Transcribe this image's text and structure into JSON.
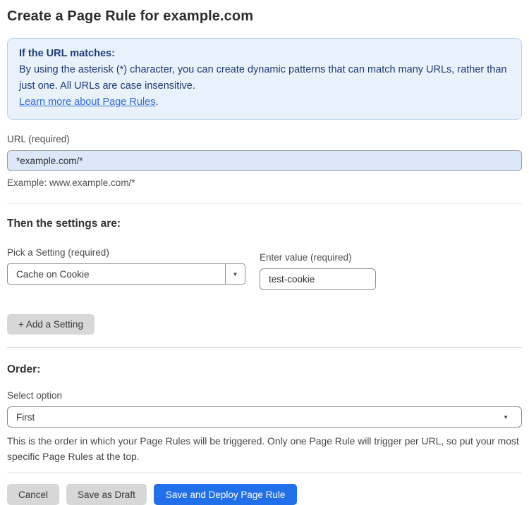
{
  "page": {
    "title": "Create a Page Rule for example.com"
  },
  "info_box": {
    "heading": "If the URL matches:",
    "body": "By using the asterisk (*) character, you can create dynamic patterns that can match many URLs, rather than just one. All URLs are case insensitive.",
    "link_label": "Learn more about Page Rules",
    "link_suffix": "."
  },
  "url_field": {
    "label": "URL (required)",
    "value": "*example.com/*",
    "helper": "Example: www.example.com/*"
  },
  "settings_section": {
    "heading": "Then the settings are:",
    "setting_label": "Pick a Setting (required)",
    "setting_selected": "Cache on Cookie",
    "dropdown_icon": "▼",
    "value_label": "Enter value (required)",
    "value": "test-cookie",
    "add_button_label": "+ Add a Setting"
  },
  "order_section": {
    "heading": "Order:",
    "select_label": "Select option",
    "selected_option": "First",
    "dropdown_icon": "▼",
    "helper": "This is the order in which your Page Rules will be triggered. Only one Page Rule will trigger per URL, so put your most specific Page Rules at the top."
  },
  "footer": {
    "cancel_label": "Cancel",
    "save_draft_label": "Save as Draft",
    "save_deploy_label": "Save and Deploy Page Rule"
  },
  "colors": {
    "info_box_bg": "#e9f1fb",
    "info_box_border": "#bad2ee",
    "info_text": "#1f3c77",
    "link": "#2e6bd9",
    "url_input_bg": "#dce8fa",
    "primary_button": "#2270e9",
    "secondary_button": "#d7d7d7"
  }
}
